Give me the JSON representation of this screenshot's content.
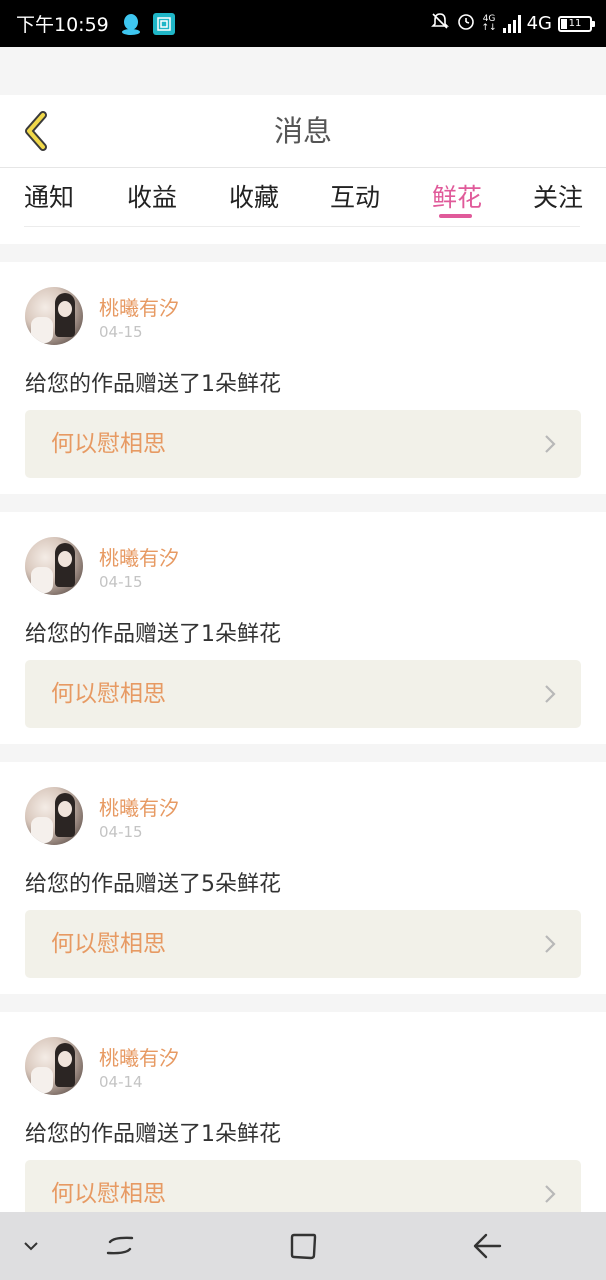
{
  "status_bar": {
    "time": "下午10:59",
    "network_small": "4G",
    "network": "4G",
    "battery": "11"
  },
  "header": {
    "title": "消息"
  },
  "tabs": [
    {
      "label": "通知"
    },
    {
      "label": "收益"
    },
    {
      "label": "收藏"
    },
    {
      "label": "互动"
    },
    {
      "label": "鲜花",
      "active": true
    },
    {
      "label": "关注"
    }
  ],
  "messages": [
    {
      "user": "桃曦有汐",
      "date": "04-15",
      "text": "给您的作品赠送了1朵鲜花",
      "work": "何以慰相思"
    },
    {
      "user": "桃曦有汐",
      "date": "04-15",
      "text": "给您的作品赠送了1朵鲜花",
      "work": "何以慰相思"
    },
    {
      "user": "桃曦有汐",
      "date": "04-15",
      "text": "给您的作品赠送了5朵鲜花",
      "work": "何以慰相思"
    },
    {
      "user": "桃曦有汐",
      "date": "04-14",
      "text": "给您的作品赠送了1朵鲜花",
      "work": "何以慰相思"
    }
  ],
  "colors": {
    "accent": "#e05a9a",
    "username": "#e79a63",
    "back_arrow": "#f0d84a",
    "link_bg": "#f2f1e9"
  },
  "icons": {
    "back": "chevron-left-icon",
    "row_arrow": "chevron-right-icon"
  }
}
